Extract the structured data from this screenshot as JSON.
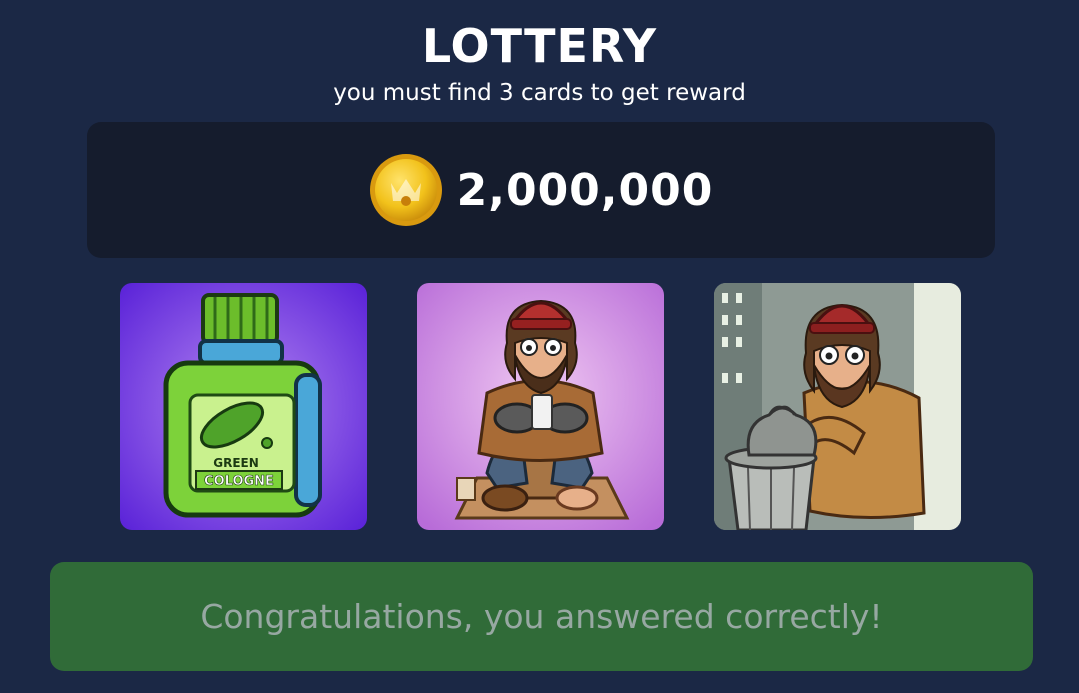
{
  "header": {
    "title": "LOTTERY",
    "subtitle": "you must find 3 cards to get reward"
  },
  "reward": {
    "icon": "gold-coin-icon",
    "amount": "2,000,000"
  },
  "cards": [
    {
      "name": "card-green-cologne",
      "label_line1": "GREEN",
      "label_line2": "COLOGNE"
    },
    {
      "name": "card-homeless-man-phone"
    },
    {
      "name": "card-homeless-man-trash"
    }
  ],
  "result": {
    "message": "Congratulations, you answered correctly!",
    "color": "#306b38"
  },
  "colors": {
    "background": "#1b2845",
    "panel": "#151c2d",
    "coin": "#f2c21b"
  }
}
